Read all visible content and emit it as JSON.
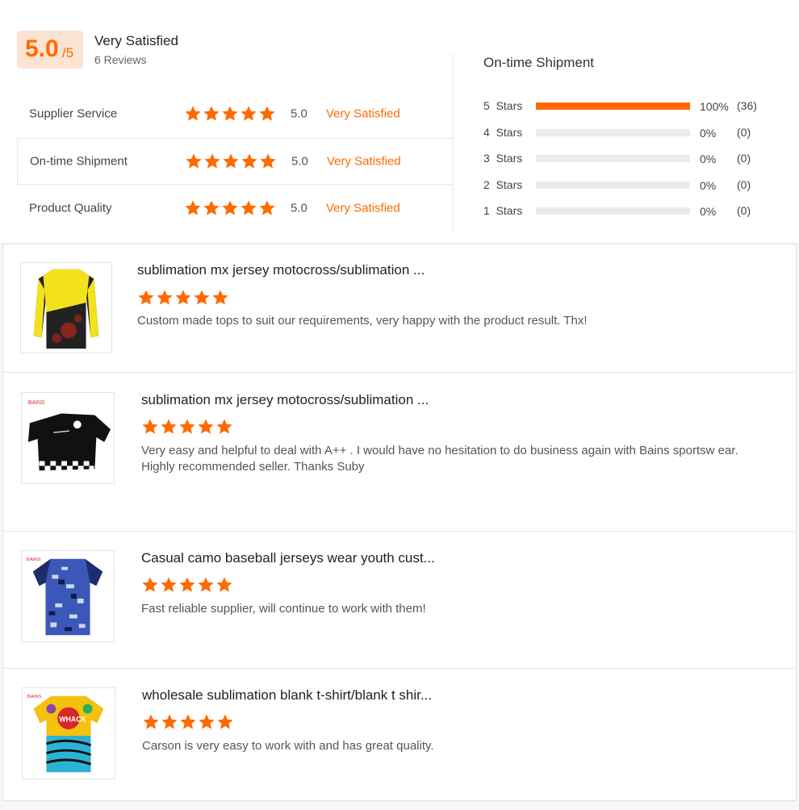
{
  "summary": {
    "score": "5.0",
    "score_max": "/5",
    "label": "Very Satisfied",
    "reviews_count": "6 Reviews",
    "accent_color": "#ff6a00"
  },
  "ratings": [
    {
      "name": "Supplier Service",
      "stars": 5,
      "score": "5.0",
      "level": "Very Satisfied"
    },
    {
      "name": "On-time Shipment",
      "stars": 5,
      "score": "5.0",
      "level": "Very Satisfied"
    },
    {
      "name": "Product Quality",
      "stars": 5,
      "score": "5.0",
      "level": "Very Satisfied"
    }
  ],
  "distribution": {
    "title": "On-time Shipment",
    "rows": [
      {
        "label": "5  Stars",
        "fraction": 1.0,
        "percent": "100%",
        "count": "(36)"
      },
      {
        "label": "4  Stars",
        "fraction": 0,
        "percent": "0%",
        "count": "(0)"
      },
      {
        "label": "3  Stars",
        "fraction": 0,
        "percent": "0%",
        "count": "(0)"
      },
      {
        "label": "2  Stars",
        "fraction": 0,
        "percent": "0%",
        "count": "(0)"
      },
      {
        "label": "1  Stars",
        "fraction": 0,
        "percent": "0%",
        "count": "(0)"
      }
    ]
  },
  "reviews": [
    {
      "title": "sublimation mx jersey motocross/sublimation ...",
      "stars": 5,
      "text": "Custom made tops to suit our requirements, very happy with the product result. Thx!",
      "image_icon": "yellow-black-motocross-jersey"
    },
    {
      "title": "sublimation mx jersey motocross/sublimation ...",
      "stars": 5,
      "text": "Very easy and helpful to deal with A++ . I would have no hesitation to do business again with Bains sportsw ear.\nHighly recommended seller. Thanks Suby",
      "image_icon": "black-checkered-mx-jersey"
    },
    {
      "title": "Casual camo baseball jerseys wear youth cust...",
      "stars": 5,
      "text": "Fast reliable supplier, will continue to work with them!",
      "image_icon": "blue-camo-baseball-jersey"
    },
    {
      "title": "wholesale sublimation blank t-shirt/blank t shir...",
      "stars": 5,
      "text": "Carson is very easy to work with and has great quality.",
      "image_icon": "colorful-comic-tshirt"
    }
  ]
}
